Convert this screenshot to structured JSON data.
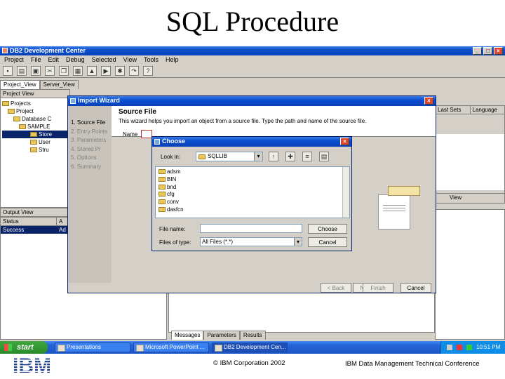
{
  "slide": {
    "title": "SQL Procedure",
    "logo": "IBM",
    "copyright": "© IBM Corporation 2002",
    "conference": "IBM Data Management Technical Conference"
  },
  "app": {
    "title": "DB2 Development Center",
    "menu": [
      "Project",
      "File",
      "Edit",
      "Debug",
      "Selected",
      "View",
      "Tools",
      "Help"
    ],
    "left_tabs": [
      "Project_View",
      "Server_View"
    ],
    "project_view_label": "Project View",
    "tree": [
      "Projects",
      "Project",
      "Database C",
      "SAMPLE",
      "Store",
      "User",
      "Stru"
    ],
    "right_headers": [
      "Last Sets",
      "Language"
    ],
    "right_mid_label": "View",
    "output_view_label": "Output View",
    "output_columns": [
      "Status",
      "A"
    ],
    "output_rows": [
      {
        "status": "Success",
        "action": "Ad"
      }
    ],
    "bottom_tabs": [
      "Messages",
      "Parameters",
      "Results"
    ]
  },
  "import_wizard": {
    "title": "Import Wizard",
    "steps": [
      "1. Source File",
      "2. Entry Points",
      "3. Parameters",
      "4. Stored Pr",
      "5. Options",
      "6. Summary"
    ],
    "heading": "Source File",
    "description": "This wizard helps you import an object from a source file. Type the path and name of the source file.",
    "name_label": "Name",
    "buttons": [
      "< Back",
      "Next >",
      "Finish",
      "Cancel"
    ]
  },
  "choose_dialog": {
    "title": "Choose",
    "look_in_label": "Look in:",
    "look_in_value": "SQLLIB",
    "folders": [
      "adsm",
      "BIN",
      "bnd",
      "cfg",
      "conv",
      "dasfcn"
    ],
    "file_name_label": "File name:",
    "file_name_value": "",
    "files_of_type_label": "Files of type:",
    "files_of_type_value": "All Files (*.*)",
    "choose_button": "Choose",
    "cancel_button": "Cancel"
  },
  "taskbar": {
    "start": "start",
    "tasks": [
      "Presentations",
      "Microsoft PowerPoint ...",
      "DB2 Development Cen..."
    ],
    "clock": "10:51 PM"
  }
}
